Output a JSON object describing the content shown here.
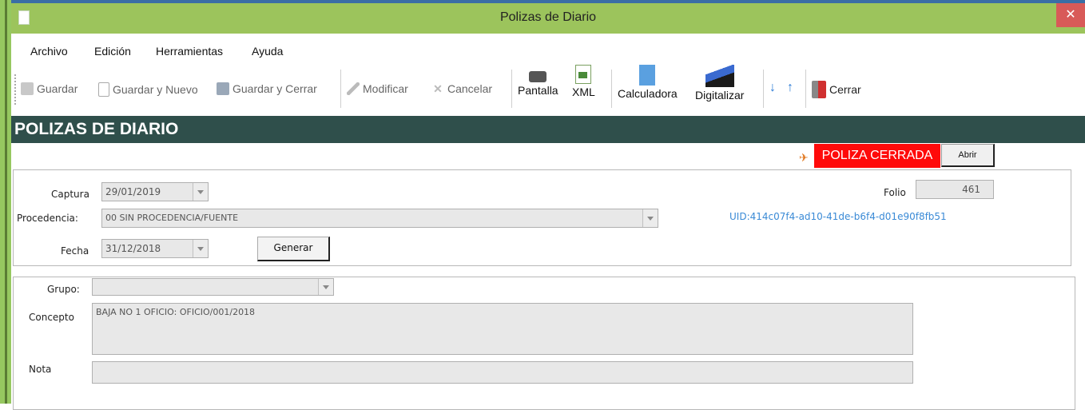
{
  "window": {
    "title": "Polizas de Diario",
    "close_glyph": "✕"
  },
  "menu": {
    "items": [
      "Archivo",
      "Edición",
      "Herramientas",
      "Ayuda"
    ]
  },
  "toolbar": {
    "guardar": "Guardar",
    "guardar_nuevo": "Guardar y Nuevo",
    "guardar_cerrar": "Guardar y Cerrar",
    "modificar": "Modificar",
    "cancelar": "Cancelar",
    "pantalla": "Pantalla",
    "xml": "XML",
    "calculadora": "Calculadora",
    "digitalizar": "Digitalizar",
    "cerrar": "Cerrar"
  },
  "header": {
    "title": "POLIZAS DE DIARIO"
  },
  "status": {
    "badge": "POLIZA CERRADA",
    "abrir": "Abrir"
  },
  "form": {
    "captura_label": "Captura",
    "captura_value": "29/01/2019",
    "procedencia_label": "Procedencia:",
    "procedencia_value": "00 SIN PROCEDENCIA/FUENTE",
    "fecha_label": "Fecha",
    "fecha_value": "31/12/2018",
    "generar": "Generar",
    "folio_label": "Folio",
    "folio_value": "461",
    "uid": "UID:414c07f4-ad10-41de-b6f4-d01e90f8fb51"
  },
  "detail": {
    "grupo_label": "Grupo:",
    "grupo_value": "",
    "concepto_label": "Concepto",
    "concepto_value": "BAJA NO 1 OFICIO: OFICIO/001/2018",
    "nota_label": "Nota",
    "nota_value": ""
  },
  "colors": {
    "titlebar": "#9cc45c",
    "header": "#2f4f4b",
    "badge": "#ff0a0a",
    "uid": "#3a8ad6"
  },
  "icons": [
    "save-icon",
    "new-doc-icon",
    "floppy-icon",
    "pencil-icon",
    "cancel-x-icon",
    "printer-icon",
    "xml-file-icon",
    "calculator-icon",
    "scanner-icon",
    "arrow-down-icon",
    "arrow-up-icon",
    "exit-door-icon",
    "pin-icon"
  ]
}
